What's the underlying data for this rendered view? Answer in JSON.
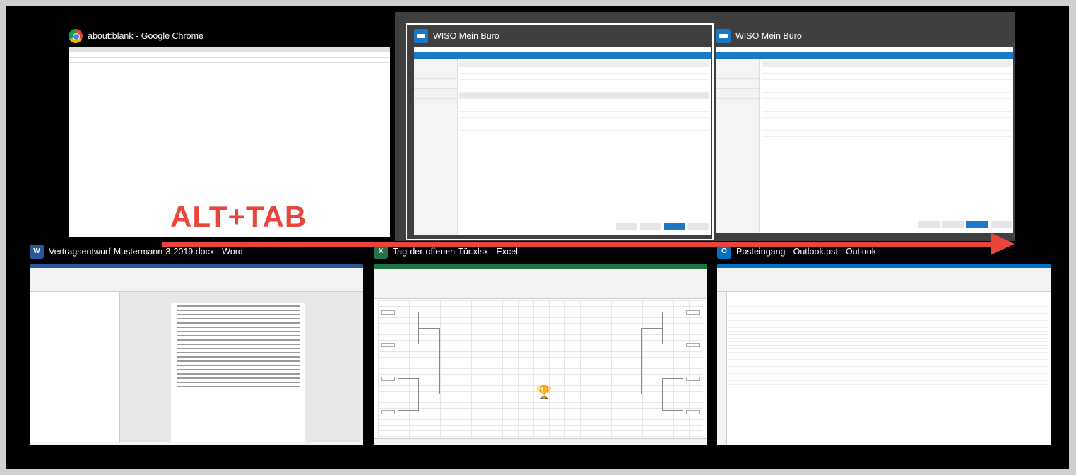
{
  "overlay": {
    "shortcut": "ALT+TAB"
  },
  "windows": [
    {
      "title": "about:blank - Google Chrome",
      "icon": "chrome-icon"
    },
    {
      "title": "WISO Mein Büro",
      "icon": "wiso-icon",
      "selected": true
    },
    {
      "title": "WISO Mein Büro",
      "icon": "wiso-icon"
    },
    {
      "title": "Vertragsentwurf-Mustermann-3-2019.docx - Word",
      "icon": "word-icon"
    },
    {
      "title": "Tag-der-offenen-Tür.xlsx - Excel",
      "icon": "excel-icon"
    },
    {
      "title": "Posteingang - Outlook.pst - Outlook",
      "icon": "outlook-icon"
    }
  ],
  "colors": {
    "switcher_bg": "#000000",
    "highlight_bg": "#3f3f3f",
    "accent_red": "#e8463c",
    "wiso_blue": "#1b78c6",
    "word_blue": "#2b579a",
    "excel_green": "#217346",
    "outlook_blue": "#0072c6"
  }
}
